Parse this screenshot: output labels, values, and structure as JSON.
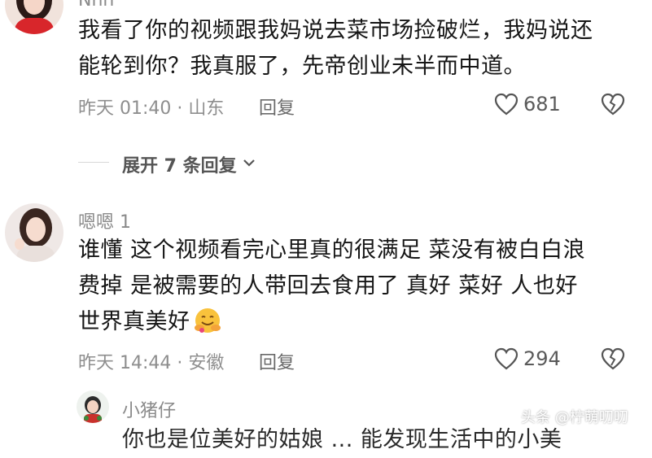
{
  "comments": [
    {
      "name": "Nnn",
      "text_lines": [
        "我看了你的视频跟我妈说去菜市场捡破烂，我妈说还",
        "能轮到你？我真服了，先帝创业未半而中道。"
      ],
      "meta": "昨天 01:40 · 山东",
      "reply_label": "回复",
      "likes": "681"
    },
    {
      "name": "嗯嗯 1",
      "text_lines": [
        "谁懂 这个视频看完心里真的很满足 菜没有被白白浪",
        "费掉 是被需要的人带回去食用了 真好 菜好 人也好",
        "世界真美好"
      ],
      "meta": "昨天 14:44 · 安徽",
      "reply_label": "回复",
      "likes": "294",
      "emoji": "hugging-face"
    },
    {
      "name": "小猪仔",
      "text_lines": [
        "你也是位美好的姑娘 ... 能发现生活中的小美"
      ]
    }
  ],
  "expand_replies": "展开 7 条回复",
  "watermark": "头条 @柠萌叨叨",
  "icons": {
    "like": "heart-outline-icon",
    "dislike": "broken-heart-icon",
    "expand": "chevron-down-icon"
  },
  "colors": {
    "meta_gray": "#8e8e8e",
    "avatar_red": "#d8262b"
  }
}
